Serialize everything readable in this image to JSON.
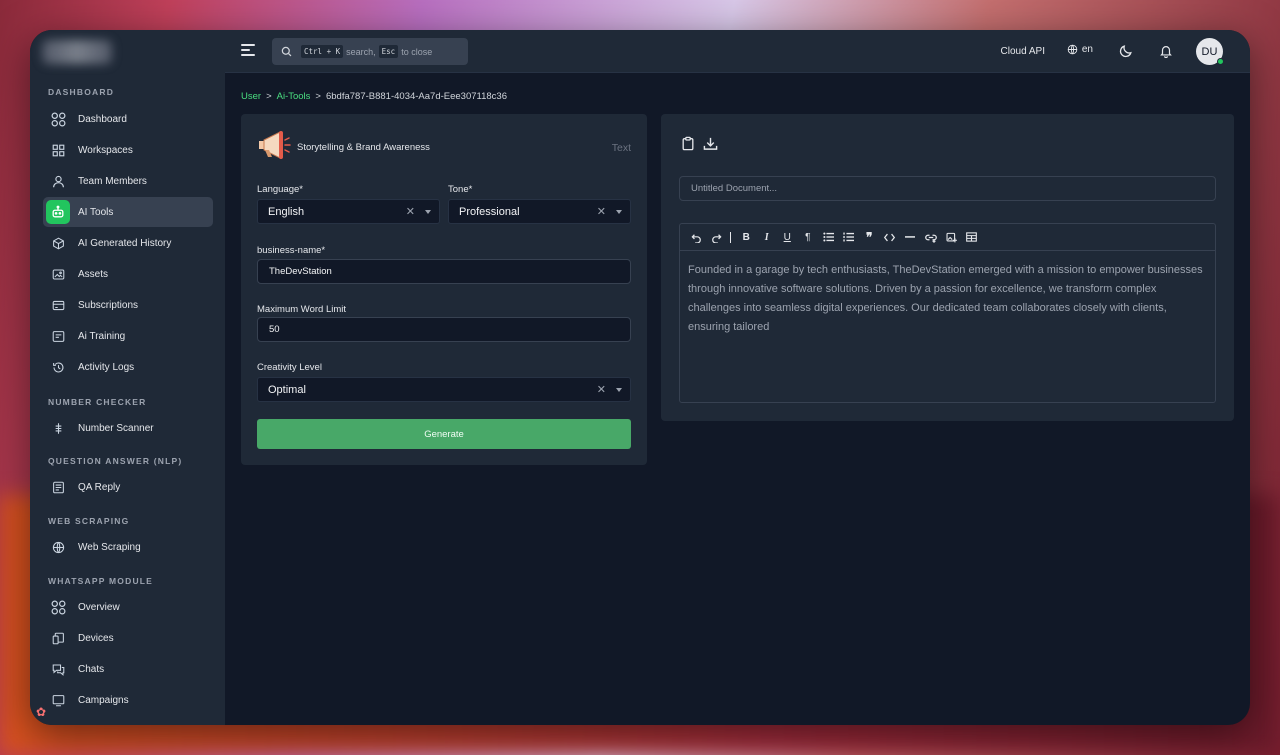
{
  "topbar": {
    "search": {
      "prefix_key": "Ctrl + K",
      "middle": "search,",
      "esc_key": "Esc",
      "suffix": "to close"
    },
    "cloud_api": "Cloud API",
    "language": "en",
    "avatar_initials": "DU"
  },
  "sidebar": {
    "sections": [
      {
        "label": "DASHBOARD"
      },
      {
        "label": "NUMBER CHECKER"
      },
      {
        "label": "QUESTION ANSWER (NLP)"
      },
      {
        "label": "WEB SCRAPING"
      },
      {
        "label": "WHATSAPP MODULE"
      }
    ],
    "items": [
      {
        "label": "Dashboard",
        "icon": "grid-circles-icon"
      },
      {
        "label": "Workspaces",
        "icon": "grid-squares-icon"
      },
      {
        "label": "Team Members",
        "icon": "user-icon"
      },
      {
        "label": "AI Tools",
        "icon": "robot-icon",
        "active": true
      },
      {
        "label": "AI Generated History",
        "icon": "cube-icon"
      },
      {
        "label": "Assets",
        "icon": "image-icon"
      },
      {
        "label": "Subscriptions",
        "icon": "card-icon"
      },
      {
        "label": "Ai Training",
        "icon": "training-icon"
      },
      {
        "label": "Activity Logs",
        "icon": "history-icon"
      },
      {
        "label": "Number Scanner",
        "icon": "scanner-icon"
      },
      {
        "label": "QA Reply",
        "icon": "document-icon"
      },
      {
        "label": "Web Scraping",
        "icon": "globe-icon"
      },
      {
        "label": "Overview",
        "icon": "grid-circles-icon"
      },
      {
        "label": "Devices",
        "icon": "devices-icon"
      },
      {
        "label": "Chats",
        "icon": "chat-icon"
      },
      {
        "label": "Campaigns",
        "icon": "campaign-icon"
      }
    ]
  },
  "breadcrumb": {
    "items": [
      "User",
      "Ai-Tools",
      "6bdfa787-B881-4034-Aa7d-Eee307118c36"
    ],
    "separator": ">"
  },
  "form": {
    "tool_title": "Storytelling & Brand Awareness",
    "tool_type": "Text",
    "language": {
      "label": "Language*",
      "value": "English"
    },
    "tone": {
      "label": "Tone*",
      "value": "Professional"
    },
    "business_name": {
      "label": "business-name*",
      "value": "TheDevStation"
    },
    "max_words": {
      "label": "Maximum Word Limit",
      "value": "50"
    },
    "creativity": {
      "label": "Creativity Level",
      "value": "Optimal"
    },
    "generate_label": "Generate"
  },
  "output": {
    "doc_title_placeholder": "Untitled Document...",
    "content": "Founded in a garage by tech enthusiasts, TheDevStation emerged with a mission to empower businesses through innovative software solutions. Driven by a passion for excellence, we transform complex challenges into seamless digital experiences. Our dedicated team collaborates closely with clients, ensuring tailored"
  },
  "colors": {
    "accent": "#22c55e",
    "generate_button": "#48a868",
    "link": "#4ade80",
    "sidebar_bg": "#1f2937",
    "main_bg": "#111827"
  }
}
